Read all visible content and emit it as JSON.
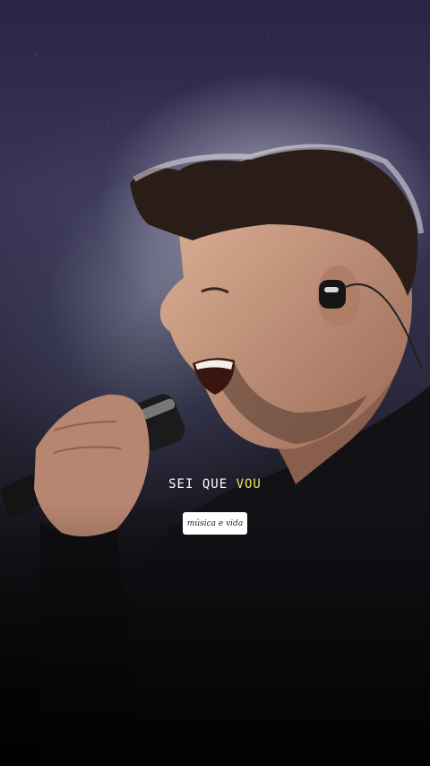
{
  "lyric": {
    "prefix": "SEI QUE ",
    "highlight": "VOU",
    "highlight_color": "#e9e35a"
  },
  "sticker": {
    "label": "música e vida"
  }
}
